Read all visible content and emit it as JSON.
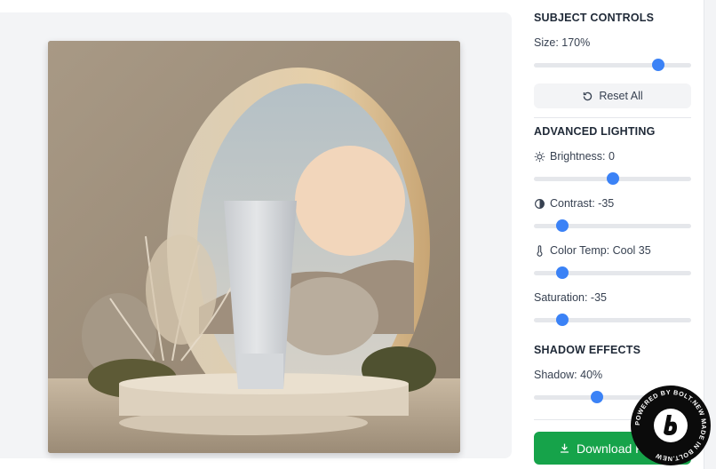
{
  "subject_controls": {
    "title": "SUBJECT CONTROLS",
    "size_label": "Size: 170%",
    "size_value": 0.79,
    "reset_label": "Reset All"
  },
  "advanced_lighting": {
    "title": "ADVANCED LIGHTING",
    "brightness_label": "Brightness: 0",
    "brightness_value": 0.5,
    "contrast_label": "Contrast: -35",
    "contrast_value": 0.18,
    "color_temp_label": "Color Temp: Cool 35",
    "color_temp_value": 0.18,
    "saturation_label": "Saturation: -35",
    "saturation_value": 0.18
  },
  "shadow_effects": {
    "title": "SHADOW EFFECTS",
    "shadow_label": "Shadow: 40%",
    "shadow_value": 0.4
  },
  "download": {
    "label": "Download R"
  },
  "badge": {
    "text": "POWERED BY BOLT.NEW MADE IN BOLT.NEW"
  },
  "colors": {
    "accent": "#3b82f6",
    "download": "#16a34a",
    "track": "#e5e7eb"
  },
  "icons": [
    "reset-icon",
    "sun-icon",
    "contrast-icon",
    "thermometer-icon",
    "download-icon",
    "bolt-logo-icon"
  ]
}
